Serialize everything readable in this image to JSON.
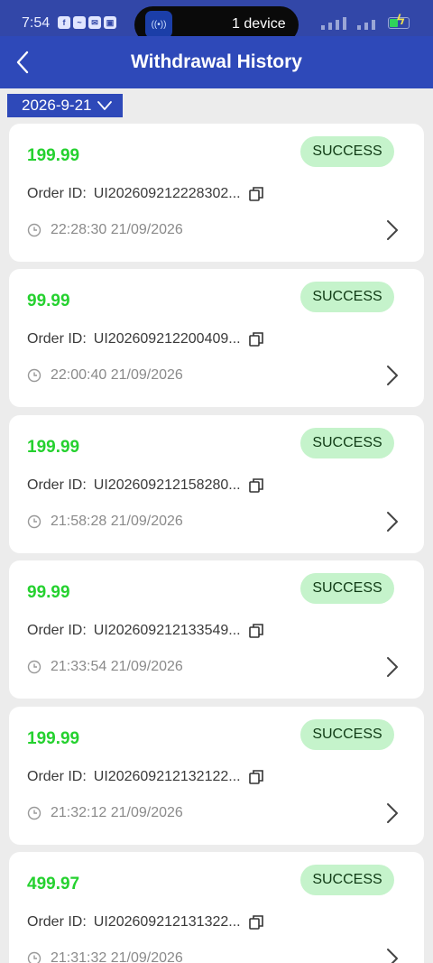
{
  "status_bar": {
    "time": "7:54",
    "island_text": "1 device"
  },
  "header": {
    "title": "Withdrawal History"
  },
  "filter": {
    "date": "2026-9-21"
  },
  "records": [
    {
      "amount": "199.99",
      "status": "SUCCESS",
      "order_label": "Order ID:",
      "order_id": "UI202609212228302...",
      "datetime": "22:28:30 21/09/2026"
    },
    {
      "amount": "99.99",
      "status": "SUCCESS",
      "order_label": "Order ID:",
      "order_id": "UI202609212200409...",
      "datetime": "22:00:40 21/09/2026"
    },
    {
      "amount": "199.99",
      "status": "SUCCESS",
      "order_label": "Order ID:",
      "order_id": "UI202609212158280...",
      "datetime": "21:58:28 21/09/2026"
    },
    {
      "amount": "99.99",
      "status": "SUCCESS",
      "order_label": "Order ID:",
      "order_id": "UI202609212133549...",
      "datetime": "21:33:54 21/09/2026"
    },
    {
      "amount": "199.99",
      "status": "SUCCESS",
      "order_label": "Order ID:",
      "order_id": "UI202609212132122...",
      "datetime": "21:32:12 21/09/2026"
    },
    {
      "amount": "499.97",
      "status": "SUCCESS",
      "order_label": "Order ID:",
      "order_id": "UI202609212131322...",
      "datetime": "21:31:32 21/09/2026"
    }
  ],
  "colors": {
    "header": "#2e49b9",
    "amount": "#25d12f",
    "badge_bg": "#c5f3cb",
    "page_bg": "#ececec"
  },
  "icons": {
    "back": "chevron-left-icon",
    "dropdown": "chevron-down-icon",
    "copy": "copy-icon",
    "clock": "clock-icon",
    "detail": "chevron-right-icon"
  }
}
